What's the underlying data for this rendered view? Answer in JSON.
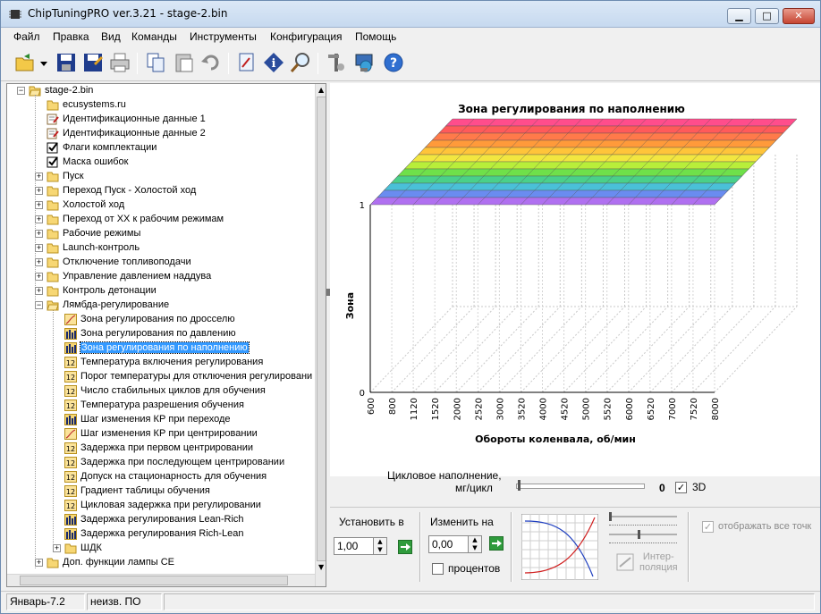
{
  "window": {
    "title": "ChipTuningPRO ver.3.21 - stage-2.bin",
    "buttons": {
      "minimize": "▁",
      "maximize": "□",
      "close": "✕"
    }
  },
  "menu": [
    "Файл",
    "Правка",
    "Вид",
    "Команды",
    "Инструменты",
    "Конфигурация",
    "Помощь"
  ],
  "toolbar_icons": [
    "open-icon",
    "dropdown-arrow-icon",
    "save-icon",
    "save-as-icon",
    "print-icon",
    "copy-icon",
    "paste-icon",
    "undo-icon",
    "edit-map-icon",
    "info-icon",
    "search-icon",
    "tools-icon",
    "network-icon",
    "help-icon"
  ],
  "tree": {
    "root": "stage-2.bin",
    "items": [
      {
        "label": "ecusystems.ru",
        "icon": "folder-icon",
        "level": 1,
        "expander": ""
      },
      {
        "label": "Идентификационные данные 1",
        "icon": "edit-doc-icon",
        "level": 1,
        "expander": ""
      },
      {
        "label": "Идентификационные данные 2",
        "icon": "edit-doc-icon",
        "level": 1,
        "expander": ""
      },
      {
        "label": "Флаги комплектации",
        "icon": "checkbox-icon",
        "level": 1,
        "expander": ""
      },
      {
        "label": "Маска ошибок",
        "icon": "checkbox-icon",
        "level": 1,
        "expander": ""
      },
      {
        "label": "Пуск",
        "icon": "folder-icon",
        "level": 1,
        "expander": "+"
      },
      {
        "label": "Переход Пуск - Холостой ход",
        "icon": "folder-icon",
        "level": 1,
        "expander": "+"
      },
      {
        "label": "Холостой ход",
        "icon": "folder-icon",
        "level": 1,
        "expander": "+"
      },
      {
        "label": "Переход от ХХ к рабочим режимам",
        "icon": "folder-icon",
        "level": 1,
        "expander": "+"
      },
      {
        "label": "Рабочие режимы",
        "icon": "folder-icon",
        "level": 1,
        "expander": "+"
      },
      {
        "label": "Launch-контроль",
        "icon": "folder-icon",
        "level": 1,
        "expander": "+"
      },
      {
        "label": "Отключение топливоподачи",
        "icon": "folder-icon",
        "level": 1,
        "expander": "+"
      },
      {
        "label": "Управление давлением наддува",
        "icon": "folder-icon",
        "level": 1,
        "expander": "+"
      },
      {
        "label": "Контроль детонации",
        "icon": "folder-icon",
        "level": 1,
        "expander": "+"
      },
      {
        "label": "Лямбда-регулирование",
        "icon": "folder-open-icon",
        "level": 1,
        "expander": "−"
      },
      {
        "label": "Зона регулирования по дросселю",
        "icon": "curve-icon",
        "level": 2,
        "expander": ""
      },
      {
        "label": "Зона регулирования по давлению",
        "icon": "table-icon",
        "level": 2,
        "expander": ""
      },
      {
        "label": "Зона регулирования по наполнению",
        "icon": "table-icon",
        "level": 2,
        "expander": "",
        "selected": true
      },
      {
        "label": "Температура включения регулирования",
        "icon": "constant-icon",
        "level": 2,
        "expander": ""
      },
      {
        "label": "Порог температуры для отключения регулировани",
        "icon": "constant-icon",
        "level": 2,
        "expander": ""
      },
      {
        "label": "Число стабильных циклов для обучения",
        "icon": "constant-icon",
        "level": 2,
        "expander": ""
      },
      {
        "label": "Температура разрешения обучения",
        "icon": "constant-icon",
        "level": 2,
        "expander": ""
      },
      {
        "label": "Шаг изменения КР при переходе",
        "icon": "table-icon",
        "level": 2,
        "expander": ""
      },
      {
        "label": "Шаг изменения КР при центрировании",
        "icon": "curve-icon",
        "level": 2,
        "expander": ""
      },
      {
        "label": "Задержка при первом центрировании",
        "icon": "constant-icon",
        "level": 2,
        "expander": ""
      },
      {
        "label": "Задержка при последующем центрировании",
        "icon": "constant-icon",
        "level": 2,
        "expander": ""
      },
      {
        "label": "Допуск на стационарность для обучения",
        "icon": "constant-icon",
        "level": 2,
        "expander": ""
      },
      {
        "label": "Градиент таблицы обучения",
        "icon": "constant-icon",
        "level": 2,
        "expander": ""
      },
      {
        "label": "Цикловая задержка при регулировании",
        "icon": "constant-icon",
        "level": 2,
        "expander": ""
      },
      {
        "label": "Задержка регулирования Lean-Rich",
        "icon": "table-icon",
        "level": 2,
        "expander": ""
      },
      {
        "label": "Задержка регулирования Rich-Lean",
        "icon": "table-icon",
        "level": 2,
        "expander": ""
      },
      {
        "label": "ШДК",
        "icon": "folder-icon",
        "level": 2,
        "expander": "+"
      },
      {
        "label": "Доп. функции лампы CE",
        "icon": "folder-icon",
        "level": 1,
        "expander": "+"
      }
    ],
    "constant_icon_text": "12"
  },
  "chart_data": {
    "type": "surface-3d",
    "title": "Зона регулирования по наполнению",
    "xlabel": "Обороты коленвала, об/мин",
    "ylabel": "Зона",
    "x": [
      600,
      800,
      1120,
      1520,
      2000,
      2520,
      3000,
      3520,
      4000,
      4520,
      5000,
      5520,
      6000,
      6520,
      7000,
      7520,
      8000
    ],
    "y_ticks": [
      "0",
      "1"
    ],
    "ylim": [
      0,
      1
    ],
    "depth_axis_label": "Цикловое наполнение, мг/цикл",
    "z_value": 1,
    "grid": true
  },
  "controls": {
    "fill_label": "Цикловое наполнение, мг/цикл",
    "fill_value": "0",
    "check_3d_label": "3D",
    "check_3d": true,
    "set_label": "Установить в",
    "set_value": "1,00",
    "change_label": "Изменить на",
    "change_value": "0,00",
    "percent_label": "процентов",
    "interp_label": "Интер-\nполяция",
    "show_all_label": "отображать все точк"
  },
  "status": {
    "cell1": "Январь-7.2",
    "cell2": "неизв. ПО"
  },
  "colors": {
    "selection": "#3399ff",
    "title_bar": "#c6d9ef",
    "close_button": "#c64532"
  }
}
